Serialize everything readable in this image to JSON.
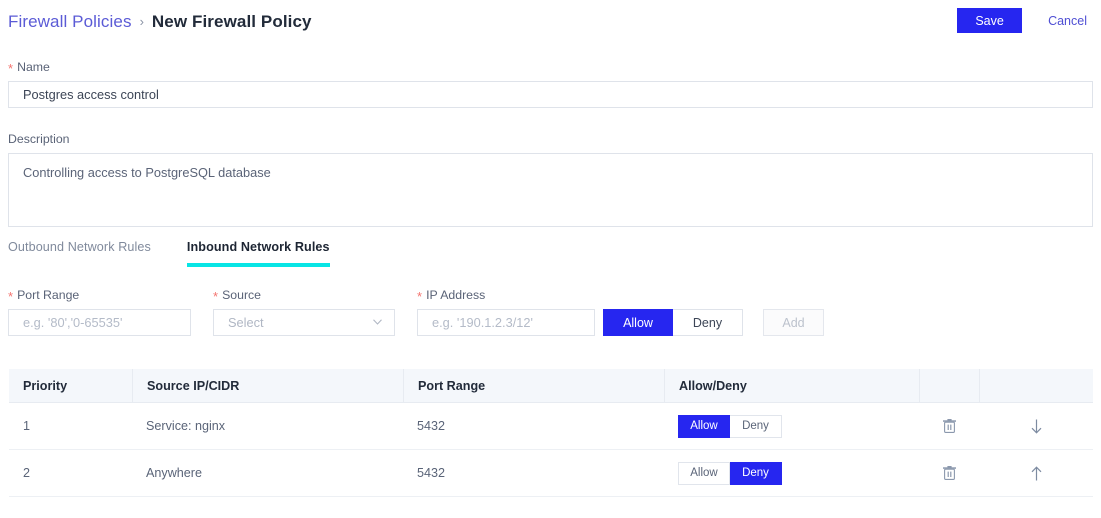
{
  "header": {
    "breadcrumb": {
      "parent": "Firewall Policies",
      "separator": "›",
      "current": "New Firewall Policy"
    },
    "save_label": "Save",
    "cancel_label": "Cancel"
  },
  "colors": {
    "accent_blue": "#2626f0",
    "link_purple": "#5b5bd6",
    "tab_underline_cyan": "#07e5e5",
    "required_red": "#f4746f",
    "table_header_bg": "#f4f7fb"
  },
  "form": {
    "name": {
      "label": "Name",
      "required": true,
      "value": "Postgres access control",
      "placeholder": ""
    },
    "description": {
      "label": "Description",
      "required": false,
      "value": "Controlling access to PostgreSQL database",
      "placeholder": ""
    }
  },
  "tabs": [
    {
      "label": "Outbound Network Rules",
      "active": false
    },
    {
      "label": "Inbound Network Rules",
      "active": true
    }
  ],
  "rule_entry": {
    "port_range": {
      "label": "Port Range",
      "required": true,
      "value": "",
      "placeholder": "e.g. '80','0-65535'"
    },
    "source": {
      "label": "Source",
      "required": true,
      "selected": "Select",
      "icon": "chevron-down-icon"
    },
    "ip_address": {
      "label": "IP Address",
      "required": true,
      "value": "",
      "placeholder": "e.g. '190.1.2.3/12'"
    },
    "allow_label": "Allow",
    "deny_label": "Deny",
    "allow_active": true,
    "add_label": "Add",
    "add_disabled": true
  },
  "table": {
    "columns": [
      "Priority",
      "Source IP/CIDR",
      "Port Range",
      "Allow/Deny",
      "",
      ""
    ],
    "rows": [
      {
        "priority": "1",
        "source": "Service: nginx",
        "port_range": "5432",
        "allow_label": "Allow",
        "deny_label": "Deny",
        "selection": "allow",
        "delete_icon": "trash-icon",
        "move_icon": "arrow-down-icon"
      },
      {
        "priority": "2",
        "source": "Anywhere",
        "port_range": "5432",
        "allow_label": "Allow",
        "deny_label": "Deny",
        "selection": "deny",
        "delete_icon": "trash-icon",
        "move_icon": "arrow-up-icon"
      }
    ]
  }
}
